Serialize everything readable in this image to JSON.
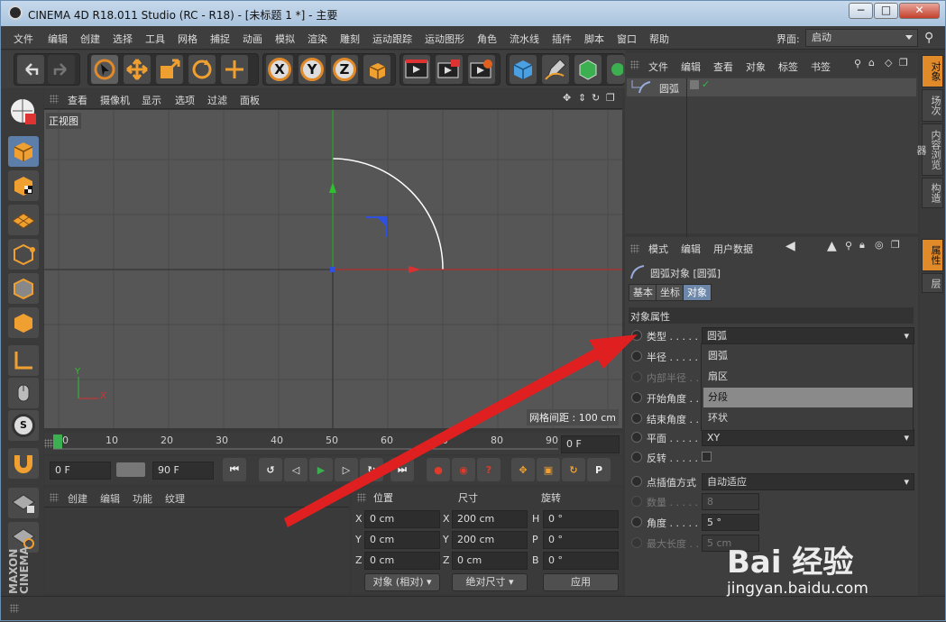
{
  "titlebar": {
    "title": "CINEMA 4D R18.011 Studio (RC - R18) - [未标题 1 *] - 主要",
    "min": "−",
    "max": "□",
    "close": "✕"
  },
  "menu": {
    "items": [
      "文件",
      "编辑",
      "创建",
      "选择",
      "工具",
      "网格",
      "捕捉",
      "动画",
      "模拟",
      "渲染",
      "雕刻",
      "运动跟踪",
      "运动图形",
      "角色",
      "流水线",
      "插件",
      "脚本",
      "窗口",
      "帮助"
    ],
    "layout_label": "界面:",
    "layout_value": "启动"
  },
  "toolbar": {
    "icons": [
      "undo-icon",
      "redo-icon",
      "live-select-icon",
      "move-icon",
      "scale-icon",
      "rotate-icon",
      "move-axis-icon",
      "x-axis-icon",
      "y-axis-icon",
      "z-axis-icon",
      "coord-system-icon",
      "render-view-icon",
      "render-picture-icon",
      "render-settings-icon",
      "cube-icon",
      "pen-icon",
      "subdivision-icon",
      "deformer-icon"
    ],
    "axis_x": "X",
    "axis_y": "Y",
    "axis_z": "Z"
  },
  "viewport": {
    "menu": [
      "查看",
      "摄像机",
      "显示",
      "选项",
      "过滤",
      "面板"
    ],
    "view_label": "正视图",
    "grid_label": "网格间距 : 100 cm",
    "axis_x": "X",
    "axis_y": "Y"
  },
  "timeline": {
    "ticks": [
      "0",
      "10",
      "20",
      "30",
      "40",
      "50",
      "60",
      "70",
      "80",
      "90"
    ],
    "frame_field": "0 F"
  },
  "transport": {
    "start_field": "0 F",
    "end_field": "90 F",
    "key_p": "P"
  },
  "materials": {
    "menu": [
      "创建",
      "编辑",
      "功能",
      "纹理"
    ]
  },
  "coords": {
    "headers": [
      "位置",
      "尺寸",
      "旋转"
    ],
    "rows": [
      {
        "a": "X",
        "pos": "0 cm",
        "b": "X",
        "size": "200 cm",
        "c": "H",
        "rot": "0 °"
      },
      {
        "a": "Y",
        "pos": "0 cm",
        "b": "Y",
        "size": "200 cm",
        "c": "P",
        "rot": "0 °"
      },
      {
        "a": "Z",
        "pos": "0 cm",
        "b": "Z",
        "size": "0 cm",
        "c": "B",
        "rot": "0 °"
      }
    ],
    "mode_dropdown": "对象 (相对)",
    "size_dropdown": "绝对尺寸",
    "apply": "应用"
  },
  "object_manager": {
    "menu": [
      "文件",
      "编辑",
      "查看",
      "对象",
      "标签",
      "书签"
    ],
    "object_name": "圆弧",
    "visibility_check": "✓"
  },
  "attributes": {
    "menu": [
      "模式",
      "编辑",
      "用户数据"
    ],
    "object_title": "圆弧对象 [圆弧]",
    "tabs": [
      "基本",
      "坐标",
      "对象"
    ],
    "section": "对象属性",
    "rows": {
      "type_label": "类型 . . . . .",
      "type_value": "圆弧",
      "radius_label": "半径 . . . . .",
      "inner_radius_label": "内部半径 . .",
      "start_angle_label": "开始角度 . .",
      "end_angle_label": "结束角度 . .",
      "plane_label": "平面 . . . . .",
      "plane_value": "XY",
      "reverse_label": "反转 . . . . .",
      "interp_label": "点插值方式",
      "interp_value": "自动适应",
      "count_label": "数量 . . . . .",
      "count_value": "8",
      "angle_label": "角度 . . . . .",
      "angle_value": "5 °",
      "maxlen_label": "最大长度 . .",
      "maxlen_value": "5 cm"
    },
    "popup_options": [
      "圆弧",
      "扇区",
      "分段",
      "环状"
    ],
    "popup_highlighted": "分段"
  },
  "right_tabs": {
    "top": [
      "对象",
      "场次",
      "内容浏览器",
      "构造"
    ],
    "bottom": [
      "属性",
      "层"
    ]
  },
  "watermark": {
    "brand": "Bai 经验",
    "url": "jingyan.baidu.com"
  },
  "colors": {
    "accent": "#e08a2a",
    "selected_tab": "#6c87a9",
    "arrow": "#e02020",
    "x_axis": "#d93030",
    "y_axis": "#2ec02e",
    "axis_blue": "#3050e0"
  }
}
